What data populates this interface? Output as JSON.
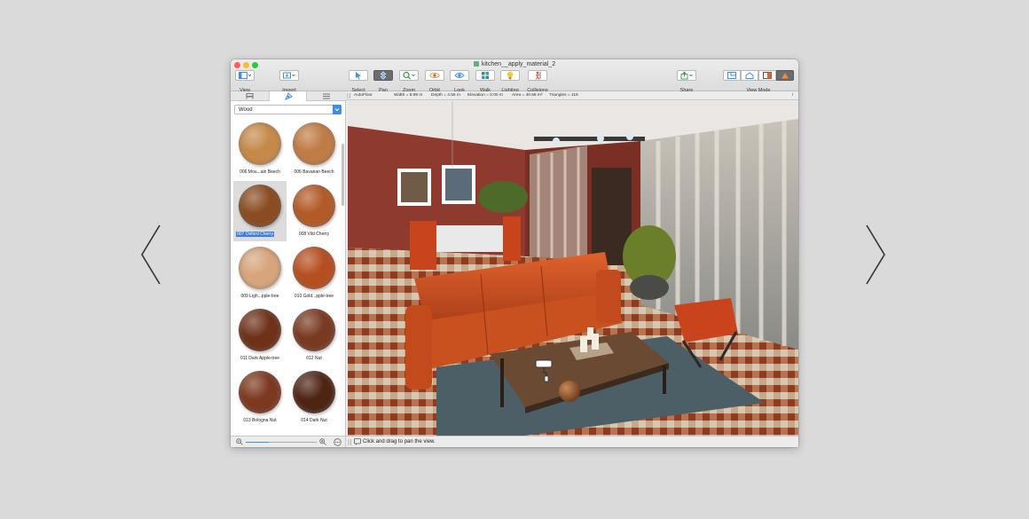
{
  "window": {
    "title": "kitchen__apply_material_2"
  },
  "toolbar": {
    "view": "View",
    "import": "Import",
    "select": "Select",
    "pan": "Pan",
    "zoom": "Zoom",
    "orbit": "Orbit",
    "look": "Look",
    "walk": "Walk",
    "lighting": "Lighting",
    "collisions": "Collisions",
    "share": "Share",
    "view_mode": "View Mode"
  },
  "info_bar": {
    "mode": "AutoFloor",
    "width": "Width = 8.98 m",
    "depth": "Depth = 4.56 m",
    "elevation": "Elevation = 0.00 m",
    "area": "Area = 40.56 m²",
    "triangles": "Triangles = 116"
  },
  "sidebar": {
    "category": "Wood",
    "materials": [
      {
        "name": "006 Mou...ain Beech",
        "color": "#c58a4a"
      },
      {
        "name": "006 Bavarian Beech",
        "color": "#c07c45"
      },
      {
        "name": "007 Oxford Cherry",
        "color": "#8a4d22",
        "selected": true
      },
      {
        "name": "008 Vild Cherry",
        "color": "#b25a28"
      },
      {
        "name": "009 Ligh...pple-tree",
        "color": "#d6a57c"
      },
      {
        "name": "010 Gold...pple-tree",
        "color": "#b54f20"
      },
      {
        "name": "011 Dark Apple-tree",
        "color": "#6e3119"
      },
      {
        "name": "012 Nut",
        "color": "#7a3a22"
      },
      {
        "name": "013 Bologna Nut",
        "color": "#7d3820"
      },
      {
        "name": "014 Dark Nut",
        "color": "#4e2414"
      }
    ]
  },
  "status": {
    "message": "Click and drag to pan the view."
  },
  "colors": {
    "accent": "#3b8fea",
    "selection": "#3d7cde"
  }
}
